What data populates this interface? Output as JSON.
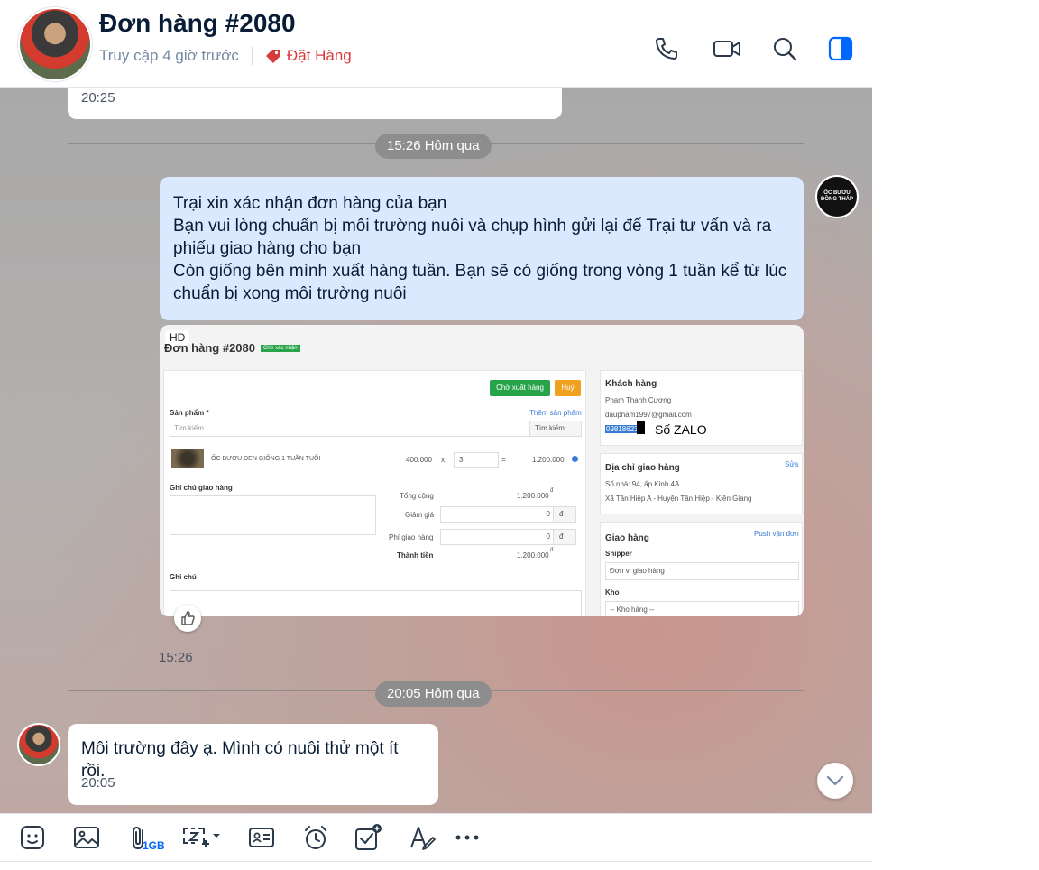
{
  "header": {
    "title": "Đơn hàng #2080",
    "status": "Truy cập 4 giờ trước",
    "tag_label": "Đặt Hàng",
    "tag_color": "#d83b3b",
    "accent": "#0068ff"
  },
  "messages": {
    "prev_time": "20:25",
    "divider1": "15:26 Hôm qua",
    "confirm_text": "Trại xin xác nhận đơn hàng của bạn\nBạn vui lòng chuẩn bị môi trường nuôi và chụp hình gửi lại để Trại tư vấn và ra phiếu giao hàng cho bạn\nCòn giống bên mình xuất hàng tuần. Bạn sẽ có giống trong vòng 1 tuần kể từ lúc chuẩn bị xong môi trường nuôi",
    "image_time": "15:26",
    "divider2": "20:05 Hôm qua",
    "reply_text": "Môi trường đây ạ. Mình có nuôi thử một ít rồi.",
    "reply_time": "20:05",
    "sender_avatar_text": "ỐC BƯƠU\nĐỒNG THÁP"
  },
  "screenshot": {
    "hd_badge": "HD",
    "order_title": "Đơn hàng #2080",
    "status_badge": "Chờ xác nhận",
    "btn_ship": "Chờ xuất hàng",
    "btn_cancel": "Huỷ",
    "product_label": "Sản phẩm *",
    "add_product": "Thêm sản phẩm",
    "search_placeholder": "Tìm kiếm...",
    "search_btn": "Tìm kiếm",
    "product_name": "ỐC BƯƠU ĐEN GIỐNG 1 TUẦN TUỔI",
    "price": "400.000",
    "times": "x",
    "qty": "3",
    "equals": "=",
    "line_total": "1.200.000",
    "delivery_note_label": "Ghi chú giao hàng",
    "subtotal_label": "Tổng cộng",
    "subtotal": "1.200.000",
    "discount_label": "Giảm giá",
    "discount": "0",
    "ship_fee_label": "Phí giao hàng",
    "ship_fee": "0",
    "currency": "đ",
    "currency_sup": "đ",
    "total_label": "Thành tiền",
    "total": "1.200.000",
    "note_label": "Ghi chú",
    "customer_heading": "Khách hàng",
    "customer_name": "Phạm Thanh Cương",
    "customer_email": "daupham1997@gmail.com",
    "customer_phone": "09818623",
    "zalo_label": "Số ZALO",
    "address_heading": "Địa chỉ giao hàng",
    "edit_link": "Sửa",
    "address_line1": "Số nhà: 94, ấp Kinh 4A",
    "address_line2": "Xã Tân Hiệp A - Huyện Tân Hiệp - Kiên Giang",
    "shipping_heading": "Giao hàng",
    "push_link": "Push vận đơn",
    "shipper_label": "Shipper",
    "shipper_placeholder": "Đơn vị giao hàng",
    "warehouse_label": "Kho",
    "warehouse_placeholder": "-- Kho hàng --"
  },
  "toolbar": {
    "file_limit": "1GB"
  }
}
